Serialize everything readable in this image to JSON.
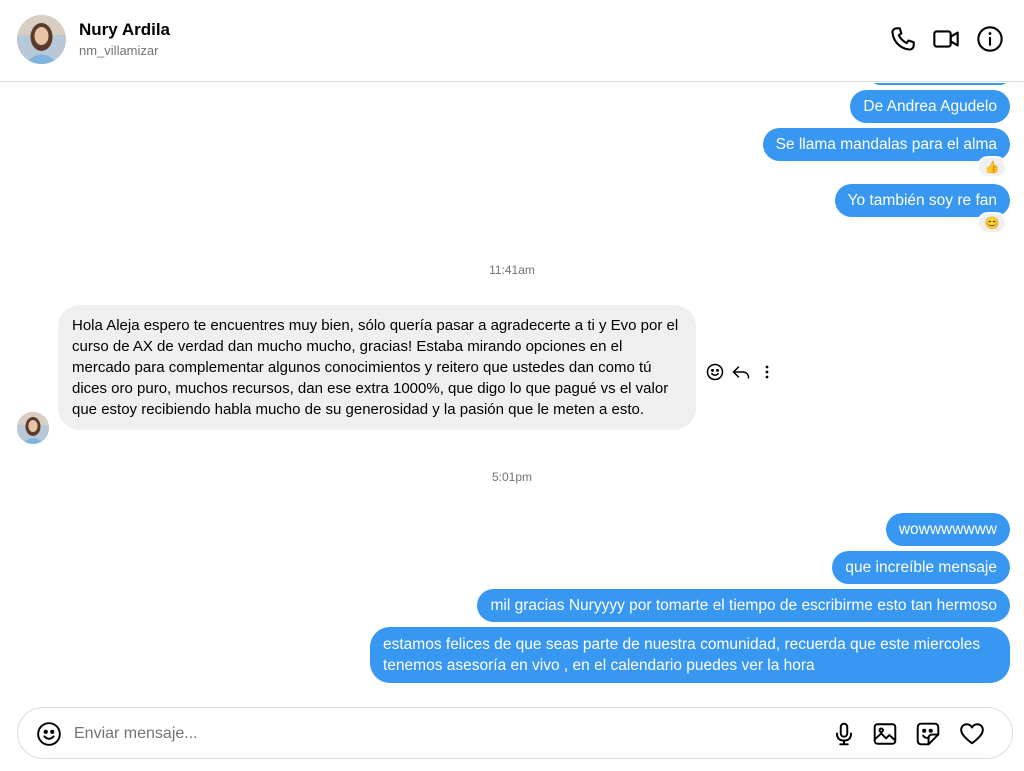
{
  "contact": {
    "name": "Nury Ardila",
    "username": "nm_villamizar"
  },
  "header_icons": [
    "phone-icon",
    "video-icon",
    "info-icon"
  ],
  "messages": {
    "sent_top": [
      {
        "text": "De Andrea Agudelo"
      },
      {
        "text": "Se llama mandalas para el alma",
        "reaction": "👍"
      },
      {
        "text": "Yo también soy re fan",
        "reaction": "😊"
      }
    ],
    "time_1": "11:41am",
    "received": {
      "text": "Hola Aleja espero te encuentres muy bien, sólo quería pasar a agradecerte a ti y Evo por el curso de AX de verdad dan mucho mucho, gracias! Estaba mirando opciones en el mercado para complementar algunos conocimientos y reitero que ustedes dan como tú dices oro puro, muchos recursos, dan ese extra 1000%, que digo lo que pagué vs el valor que estoy recibiendo habla mucho de su generosidad y la pasión que le meten a esto."
    },
    "time_2": "5:01pm",
    "sent_bottom": [
      {
        "text": "wowwwwwww"
      },
      {
        "text": "que increíble mensaje"
      },
      {
        "text": "mil gracias Nuryyyy por tomarte el tiempo de escribirme esto tan hermoso"
      },
      {
        "text": "estamos felices de que seas parte de nuestra comunidad, recuerda que este miercoles tenemos asesoría en vivo , en el calendario puedes ver la hora"
      }
    ]
  },
  "composer": {
    "placeholder": "Enviar mensaje...",
    "icons": [
      "emoji-icon",
      "microphone-icon",
      "image-icon",
      "sticker-icon",
      "heart-icon"
    ]
  },
  "colors": {
    "sent_bubble": "#3897f0",
    "received_bubble": "#efefef",
    "muted_text": "#737373",
    "divider": "#dbdbdb"
  }
}
